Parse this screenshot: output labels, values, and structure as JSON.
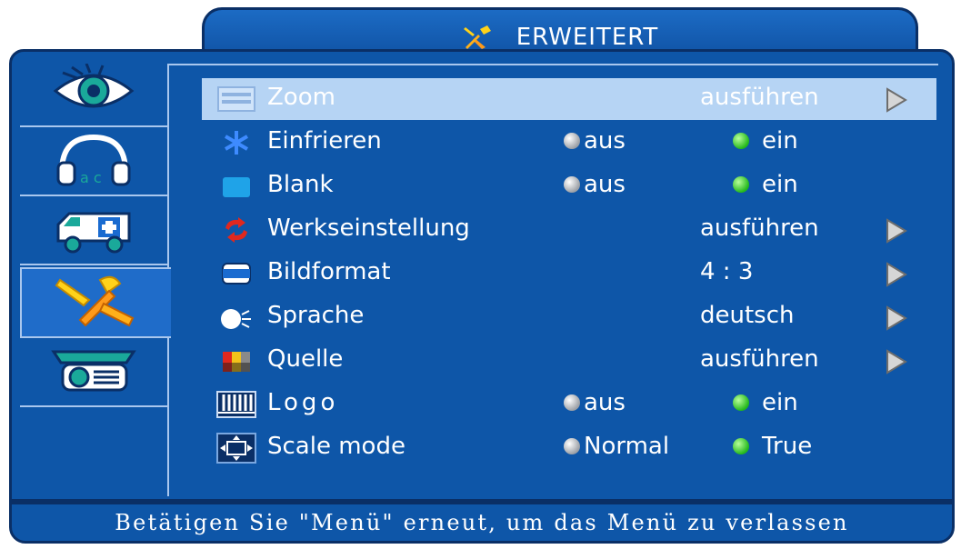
{
  "title": "ERWEITERT",
  "sidebar": {
    "tabs": [
      {
        "icon": "eye-icon"
      },
      {
        "icon": "headphones-icon"
      },
      {
        "icon": "ambulance-icon"
      },
      {
        "icon": "tools-icon",
        "active": true
      },
      {
        "icon": "projector-icon"
      }
    ]
  },
  "menu": {
    "zoom": {
      "icon": "zoom-icon",
      "label": "Zoom",
      "value": "ausführen"
    },
    "einfrieren": {
      "icon": "freeze-icon",
      "label": "Einfrieren",
      "option_off": "aus",
      "option_on": "ein",
      "selected": "ein"
    },
    "blank": {
      "icon": "blank-icon",
      "label": "Blank",
      "option_off": "aus",
      "option_on": "ein",
      "selected": "ein"
    },
    "werkseinstellung": {
      "icon": "reset-icon",
      "label": "Werkseinstellung",
      "value": "ausführen"
    },
    "bildformat": {
      "icon": "aspect-ratio-icon",
      "label": "Bildformat",
      "value": "4 : 3"
    },
    "sprache": {
      "icon": "language-icon",
      "label": "Sprache",
      "value": "deutsch"
    },
    "quelle": {
      "icon": "source-icon",
      "label": "Quelle",
      "value": "ausführen"
    },
    "logo": {
      "icon": "logo-icon",
      "label": "Logo",
      "option_off": "aus",
      "option_on": "ein",
      "selected": "ein"
    },
    "scale_mode": {
      "icon": "scale-mode-icon",
      "label": "Scale mode",
      "option_off": "Normal",
      "option_on": "True",
      "selected": "True"
    }
  },
  "selected_item": "Zoom",
  "status": "Betätigen Sie \"Menü\" erneut, um das Menü zu verlassen",
  "colors": {
    "background": "#0e56a8",
    "border": "#0a2f66",
    "highlight": "#b6d4f4",
    "radio_on": "#23b81b"
  }
}
